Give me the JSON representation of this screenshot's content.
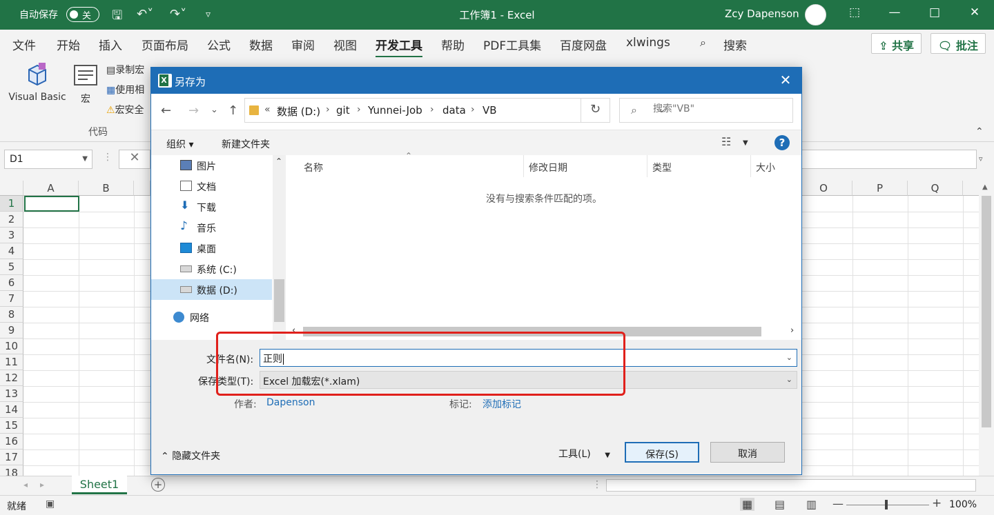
{
  "titlebar": {
    "autosave_label": "自动保存",
    "autosave_state": "关",
    "title": "工作簿1  -  Excel",
    "user": "Zcy Dapenson"
  },
  "menu": {
    "tabs": [
      "文件",
      "开始",
      "插入",
      "页面布局",
      "公式",
      "数据",
      "审阅",
      "视图",
      "开发工具",
      "帮助",
      "PDF工具集",
      "百度网盘",
      "xlwings"
    ],
    "active_tab": "开发工具",
    "search_label": "搜索",
    "share_label": "共享",
    "comment_label": "批注"
  },
  "ribbon": {
    "visual_basic": "Visual Basic",
    "macros": "宏",
    "record_macro": "录制宏",
    "use_relative": "使用相",
    "macro_security": "宏安全",
    "group_code": "代码"
  },
  "formula_bar": {
    "name_box": "D1"
  },
  "grid": {
    "left_columns": [
      "A",
      "B"
    ],
    "right_columns": [
      "O",
      "P",
      "Q"
    ],
    "rows": [
      "1",
      "2",
      "3",
      "4",
      "5",
      "6",
      "7",
      "8",
      "9",
      "10",
      "11",
      "12",
      "13",
      "14",
      "15",
      "16",
      "17",
      "18"
    ]
  },
  "sheet_tabs": {
    "sheet1": "Sheet1"
  },
  "statusbar": {
    "ready": "就绪",
    "zoom": "100%"
  },
  "dialog": {
    "title": "另存为",
    "breadcrumb": [
      "«",
      "数据 (D:)",
      "git",
      "Yunnei-Job",
      "data",
      "VB"
    ],
    "search_placeholder": "搜索\"VB\"",
    "organize": "组织 ▾",
    "new_folder": "新建文件夹",
    "nav_items": [
      {
        "label": "图片",
        "icon": "pictures-icon"
      },
      {
        "label": "文档",
        "icon": "documents-icon"
      },
      {
        "label": "下载",
        "icon": "download-icon"
      },
      {
        "label": "音乐",
        "icon": "music-icon"
      },
      {
        "label": "桌面",
        "icon": "desktop-icon"
      },
      {
        "label": "系统 (C:)",
        "icon": "drive-c-icon"
      },
      {
        "label": "数据 (D:)",
        "icon": "drive-d-icon"
      },
      {
        "label": "网络",
        "icon": "network-icon"
      }
    ],
    "selected_nav": "数据 (D:)",
    "columns": {
      "name": "名称",
      "modified": "修改日期",
      "type": "类型",
      "size": "大小"
    },
    "empty_message": "没有与搜索条件匹配的项。",
    "filename_label": "文件名(N):",
    "filename_value": "正则",
    "filetype_label": "保存类型(T):",
    "filetype_value": "Excel 加载宏(*.xlam)",
    "author_label": "作者:",
    "author_value": "Dapenson",
    "tags_label": "标记:",
    "tags_value": "添加标记",
    "hide_folders": "隐藏文件夹",
    "tools": "工具(L)",
    "save": "保存(S)",
    "cancel": "取消"
  },
  "colors": {
    "excel_green": "#217346",
    "dialog_blue": "#1e6db6",
    "highlight_red": "#e0201b"
  }
}
